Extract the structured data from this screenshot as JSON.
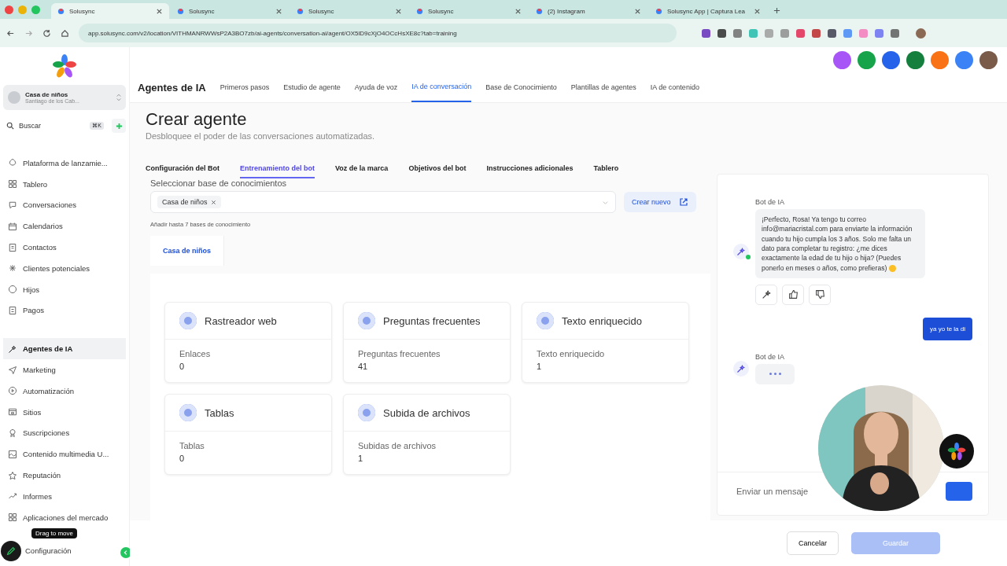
{
  "browser": {
    "tabs": [
      {
        "title": "Solusync",
        "selected": true
      },
      {
        "title": "Solusync",
        "selected": false
      },
      {
        "title": "Solusync",
        "selected": false
      },
      {
        "title": "Solusync",
        "selected": false
      },
      {
        "title": "(2) Instagram",
        "selected": false
      },
      {
        "title": "Solusync App | Captura Lea",
        "selected": false
      }
    ],
    "address": "app.solusync.com/v2/location/VITHMANRWWsP2A3BO7zb/ai-agents/conversation-ai/agent/OX5lD9cXjO4OCcHsXE8c?tab=training"
  },
  "sidebar": {
    "account": {
      "name": "Casa de niños",
      "location": "Santiago de los Cab..."
    },
    "search": {
      "placeholder": "Buscar",
      "shortcut": "⌘K"
    },
    "sections": [
      {
        "items": [
          {
            "label": "Plataforma de lanzamie...",
            "selected": false
          },
          {
            "label": "Tablero",
            "selected": false
          },
          {
            "label": "Conversaciones",
            "selected": false
          },
          {
            "label": "Calendarios",
            "selected": false
          },
          {
            "label": "Contactos",
            "selected": false
          },
          {
            "label": "Clientes potenciales",
            "selected": false
          },
          {
            "label": "Hijos",
            "selected": false
          },
          {
            "label": "Pagos",
            "selected": false
          }
        ]
      },
      {
        "items": [
          {
            "label": "Agentes de IA",
            "selected": true
          },
          {
            "label": "Marketing",
            "selected": false
          },
          {
            "label": "Automatización",
            "selected": false
          },
          {
            "label": "Sitios",
            "selected": false
          },
          {
            "label": "Suscripciones",
            "selected": false
          },
          {
            "label": "Contenido multimedia U...",
            "selected": false
          },
          {
            "label": "Reputación",
            "selected": false
          },
          {
            "label": "Informes",
            "selected": false
          },
          {
            "label": "Aplicaciones del mercado",
            "selected": false
          },
          {
            "label": "Configuración",
            "selected": false
          }
        ]
      }
    ],
    "tooltip": "Drag to move"
  },
  "header": {
    "title": "Agentes de IA",
    "nav": [
      {
        "label": "Primeros pasos",
        "selected": false
      },
      {
        "label": "Estudio de agente",
        "selected": false
      },
      {
        "label": "Ayuda de voz",
        "selected": false
      },
      {
        "label": "IA de conversación",
        "selected": true
      },
      {
        "label": "Base de Conocimiento",
        "selected": false
      },
      {
        "label": "Plantillas de agentes",
        "selected": false
      },
      {
        "label": "IA de contenido",
        "selected": false
      }
    ],
    "actions": [
      {
        "color": "#a855f7"
      },
      {
        "color": "#16a34a"
      },
      {
        "color": "#2563eb"
      },
      {
        "color": "#15803d"
      },
      {
        "color": "#f97316"
      },
      {
        "color": "#3b82f6"
      }
    ]
  },
  "page": {
    "title": "Crear agente",
    "subtitle": "Desbloquee el poder de las conversaciones automatizadas.",
    "tabs": [
      {
        "label": "Configuración del Bot",
        "selected": false
      },
      {
        "label": "Entrenamiento del bot",
        "selected": true
      },
      {
        "label": "Voz de la marca",
        "selected": false
      },
      {
        "label": "Objetivos del bot",
        "selected": false
      },
      {
        "label": "Instrucciones adicionales",
        "selected": false
      },
      {
        "label": "Tablero",
        "selected": false
      }
    ],
    "knowledge": {
      "label": "Seleccionar base de conocimientos",
      "chips": [
        "Casa de niños"
      ],
      "create_button": "Crear nuevo",
      "hint": "Añadir hasta 7 bases de conocimiento",
      "base_tabs": [
        {
          "label": "Casa de niños",
          "selected": true
        }
      ]
    },
    "cards": [
      {
        "title": "Rastreador web",
        "label": "Enlaces",
        "value": "0"
      },
      {
        "title": "Preguntas frecuentes",
        "label": "Preguntas frecuentes",
        "value": "41"
      },
      {
        "title": "Texto enriquecido",
        "label": "Texto enriquecido",
        "value": "1"
      },
      {
        "title": "Tablas",
        "label": "Tablas",
        "value": "0"
      },
      {
        "title": "Subida de archivos",
        "label": "Subidas de archivos",
        "value": "1"
      }
    ]
  },
  "chat": {
    "messages": [
      {
        "kind": "bot",
        "sender": "Bot de IA",
        "text": "¡Perfecto, Rosa! Ya tengo tu correo info@mariacristal.com para enviarte la información cuando tu hijo cumpla los 3 años. Solo me falta un dato para completar tu registro: ¿me dices exactamente la edad de tu hijo o hija? (Puedes ponerlo en meses o años, como prefieras)"
      },
      {
        "kind": "user",
        "text": "ya yo te la di"
      },
      {
        "kind": "typing",
        "sender": "Bot de IA"
      }
    ],
    "input": {
      "placeholder": "Enviar un mensaje"
    }
  },
  "footer": {
    "cancel": "Cancelar",
    "save": {
      "label": "Guardar",
      "disabled": true
    }
  }
}
